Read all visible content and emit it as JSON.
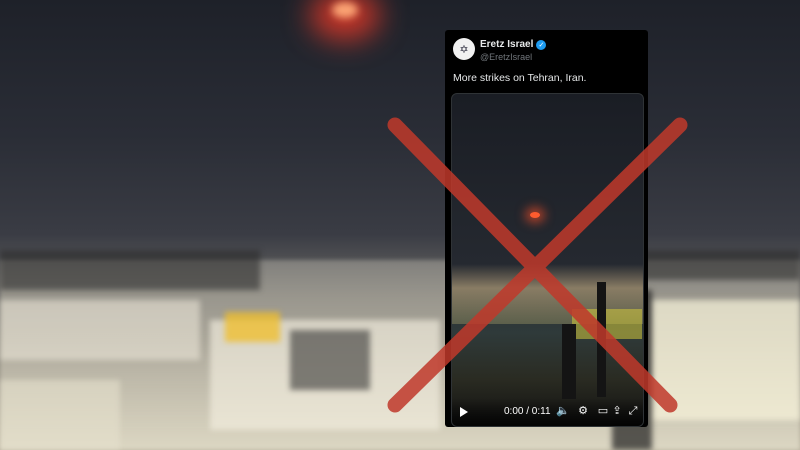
{
  "tweet": {
    "author_name": "Eretz Israel",
    "verified_badge": "✓",
    "handle": "@EretzIsrael",
    "text": "More strikes on Tehran, Iran."
  },
  "video_player": {
    "time_display": "0:00 / 0:11",
    "icons": [
      "play-icon",
      "volume-icon",
      "settings-icon",
      "pip-icon",
      "share-icon",
      "fullscreen-icon"
    ]
  },
  "overlay": {
    "x_mark_color": "#c0392b"
  }
}
